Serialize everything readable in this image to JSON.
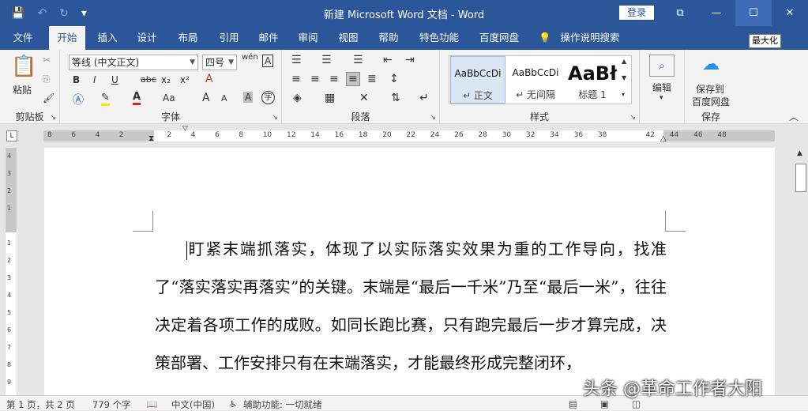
{
  "window": {
    "title": "新建 Microsoft Word 文档  -  Word",
    "login_label": "登录",
    "min_glyph": "—",
    "max_glyph": "☐",
    "close_glyph": "✕",
    "restore_glyph": "⧉"
  },
  "qat": {
    "save": "💾",
    "undo": "↶",
    "redo": "↻",
    "more": "▾"
  },
  "tabs": [
    "文件",
    "开始",
    "插入",
    "设计",
    "布局",
    "引用",
    "邮件",
    "审阅",
    "视图",
    "帮助",
    "特色功能",
    "百度网盘",
    "操作说明搜索"
  ],
  "tooltip": "最大化",
  "ribbon": {
    "clipboard": {
      "paste": "粘贴",
      "label": "剪贴板"
    },
    "font": {
      "name": "等线 (中文正文)",
      "size": "四号",
      "label": "字体",
      "bold": "B",
      "italic": "I",
      "underline": "U",
      "strike": "abc",
      "sub": "x₂",
      "sup": "x²",
      "case": "Aa",
      "grow": "A",
      "shrink": "A",
      "wen": "wén",
      "charborder": "A",
      "clear": "A",
      "charshade": "A",
      "circle": "字"
    },
    "paragraph": {
      "label": "段落"
    },
    "styles": {
      "label": "样式",
      "items": [
        {
          "preview": "AaBbCcDi",
          "name": "↵ 正文"
        },
        {
          "preview": "AaBbCcDi",
          "name": "↵ 无间隔"
        },
        {
          "preview": "AaBł",
          "name": "标题 1"
        }
      ]
    },
    "editing": {
      "label": "编辑"
    },
    "save": {
      "line1": "保存到",
      "line2": "百度网盘",
      "label": "保存"
    }
  },
  "document": {
    "paragraph": "盯紧末端抓落实，体现了以实际落实效果为重的工作导向，找准了“落实落实再落实”的关键。末端是“最后一千米”乃至“最后一米”，往往决定着各项工作的成败。如同长跑比赛，只有跑完最后一步才算完成，决策部署、工作安排只有在末端落实，才能最终形成完整闭环，"
  },
  "status": {
    "page": "第 1 页，共 2 页",
    "words": "779 个字",
    "lang": "中文(中国)",
    "access": "辅助功能: 一切就绪"
  },
  "watermark": "头条 @革命工作者大阳"
}
